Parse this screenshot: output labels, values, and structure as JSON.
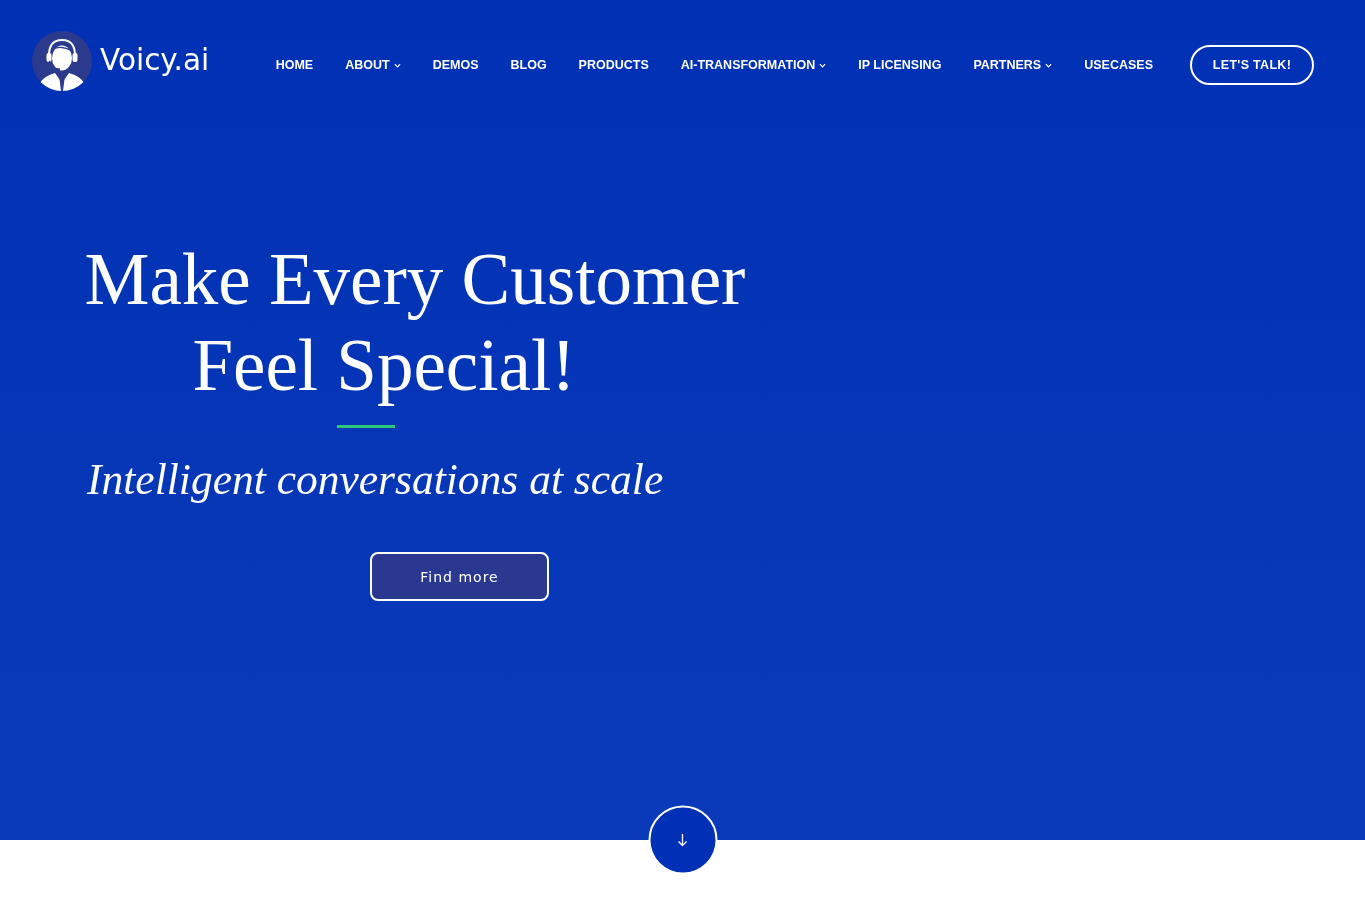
{
  "header": {
    "logo_text": "Voicy.ai",
    "nav": [
      {
        "label": "HOME",
        "has_dropdown": false
      },
      {
        "label": "ABOUT",
        "has_dropdown": true
      },
      {
        "label": "DEMOS",
        "has_dropdown": false
      },
      {
        "label": "BLOG",
        "has_dropdown": false
      },
      {
        "label": "PRODUCTS",
        "has_dropdown": false
      },
      {
        "label": "AI-TRANSFORMATION",
        "has_dropdown": true
      },
      {
        "label": "IP LICENSING",
        "has_dropdown": false
      },
      {
        "label": "PARTNERS",
        "has_dropdown": true
      },
      {
        "label": "USECASES",
        "has_dropdown": false
      }
    ],
    "cta": "LET'S TALK!"
  },
  "hero": {
    "headline_lines": [
      "Make Every Customer",
      "Feel Special!"
    ],
    "tagline": "Intelligent conversations at scale",
    "button": "Find more"
  }
}
